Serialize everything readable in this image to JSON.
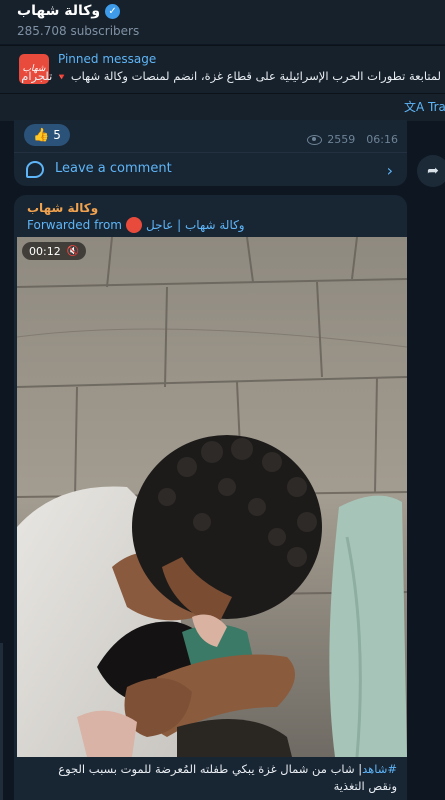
{
  "channel": {
    "name": "وكالة شهاب",
    "subscribers": "285.708 subscribers"
  },
  "pinned": {
    "label": "Pinned message",
    "text": "لمتابعة تطورات الحرب الإسرائيلية على قطاع غزة، انضم لمنصات وكالة شهاب",
    "text_suffix": "تلجرام",
    "flag": "🔻",
    "avatar_text": "شهاب"
  },
  "translate": {
    "label": "Tran"
  },
  "previous_message": {
    "reaction_emoji": "👍",
    "reaction_count": "5",
    "views": "2559",
    "time": "06:16",
    "comment_label": "Leave a comment"
  },
  "message": {
    "sender": "وكالة شهاب",
    "forwarded_prefix": "Forwarded from",
    "forwarded_from": "وكالة شهاب | عاجل",
    "video_duration": "00:12",
    "hashtag": "#شاهد",
    "caption": "| شاب من شمال غزة يبكي طفلته المُعرضة للموت بسبب الجوع ونقص التغذية"
  },
  "colors": {
    "background": "#0e1621",
    "header": "#17212b",
    "bubble": "#182533",
    "accent": "#5eb5f7",
    "sender": "#f0a24e",
    "brand": "#e84b3c"
  },
  "icons": [
    "verified-icon",
    "eye-icon",
    "comment-icon",
    "chevron-right-icon",
    "share-icon",
    "mute-icon",
    "translate-icon"
  ]
}
